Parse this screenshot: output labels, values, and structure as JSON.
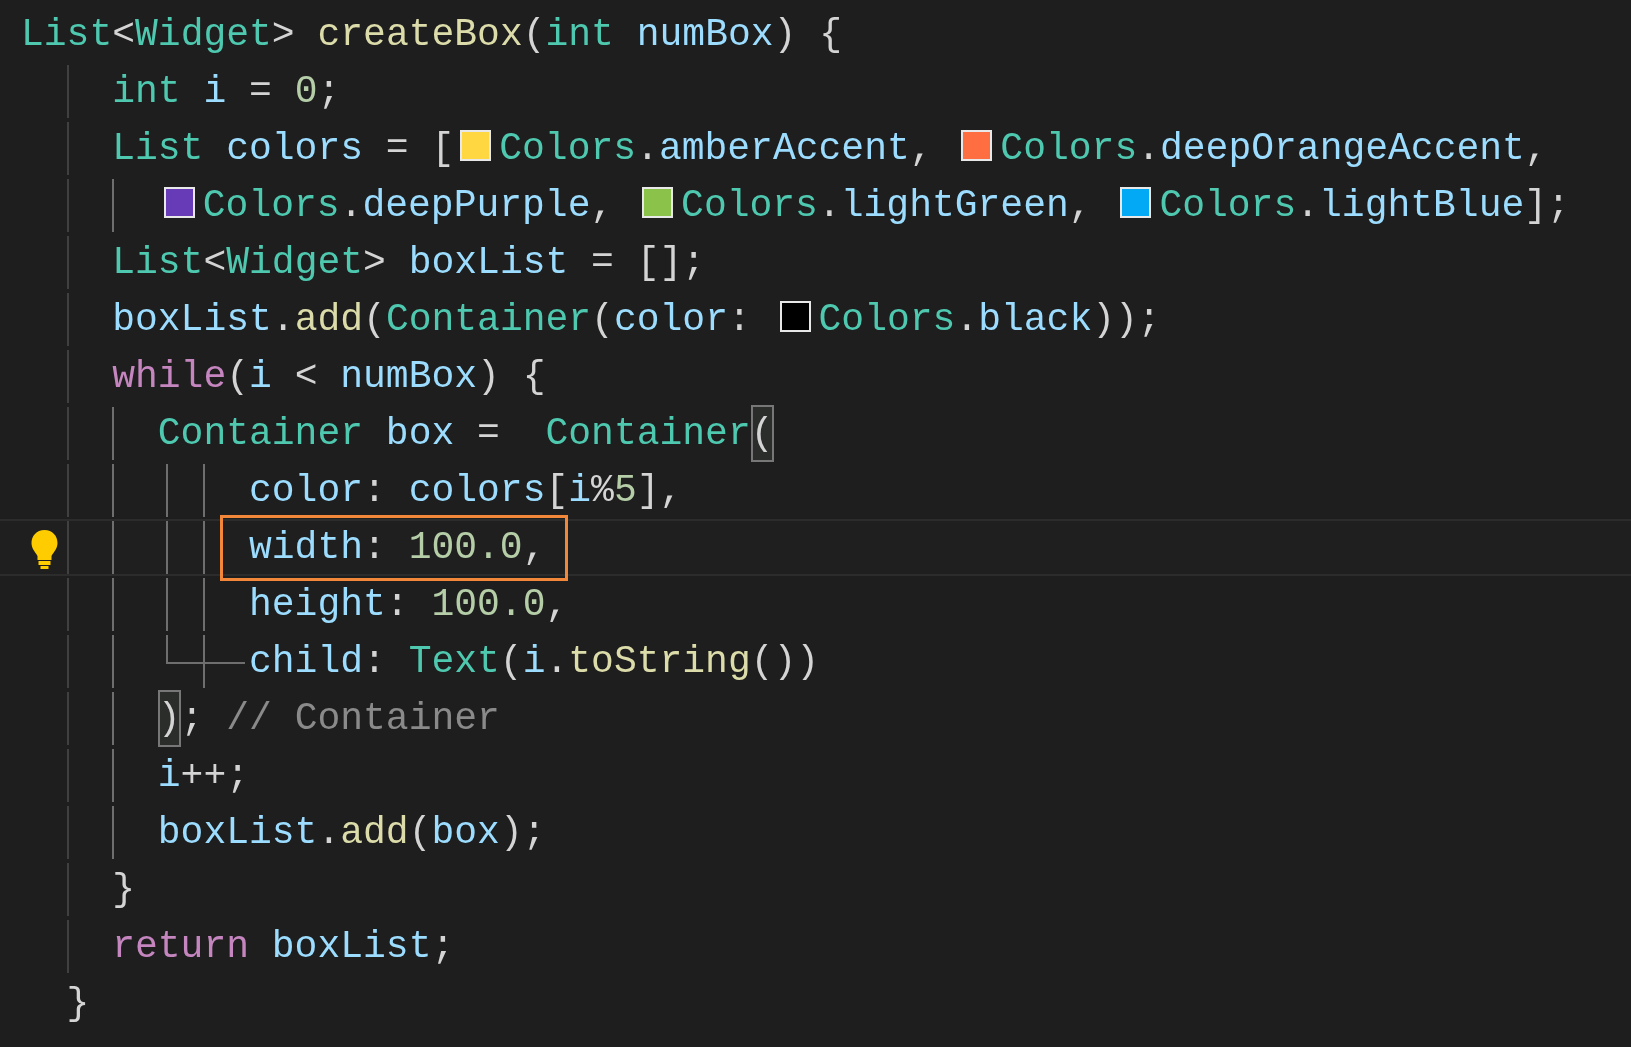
{
  "lines": [
    {
      "tokens": [
        {
          "kind": "type",
          "text": "List"
        },
        {
          "kind": "punct",
          "text": "<"
        },
        {
          "kind": "type",
          "text": "Widget"
        },
        {
          "kind": "punct",
          "text": "> "
        },
        {
          "kind": "func",
          "text": "createBox"
        },
        {
          "kind": "punct",
          "text": "("
        },
        {
          "kind": "type",
          "text": "int"
        },
        {
          "kind": "var",
          "text": " numBox"
        },
        {
          "kind": "punct",
          "text": ") {"
        }
      ],
      "children": [
        {
          "tokens": [
            {
              "kind": "type",
              "text": "int"
            },
            {
              "kind": "var",
              "text": " i"
            },
            {
              "kind": "punct",
              "text": " = "
            },
            {
              "kind": "number",
              "text": "0"
            },
            {
              "kind": "punct",
              "text": ";"
            }
          ]
        },
        {
          "tokens": [
            {
              "kind": "type",
              "text": "List"
            },
            {
              "kind": "var",
              "text": " colors"
            },
            {
              "kind": "punct",
              "text": " = ["
            },
            {
              "kind": "swatch",
              "color": "#ffd740"
            },
            {
              "kind": "type",
              "text": "Colors"
            },
            {
              "kind": "punct",
              "text": "."
            },
            {
              "kind": "var",
              "text": "amberAccent"
            },
            {
              "kind": "punct",
              "text": ", "
            },
            {
              "kind": "swatch",
              "color": "#ff6e40"
            },
            {
              "kind": "type",
              "text": "Colors"
            },
            {
              "kind": "punct",
              "text": "."
            },
            {
              "kind": "var",
              "text": "deepOrangeAccent"
            },
            {
              "kind": "punct",
              "text": ","
            }
          ],
          "children": [
            {
              "tokens": [
                {
                  "kind": "swatch",
                  "color": "#673ab7"
                },
                {
                  "kind": "type",
                  "text": "Colors"
                },
                {
                  "kind": "punct",
                  "text": "."
                },
                {
                  "kind": "var",
                  "text": "deepPurple"
                },
                {
                  "kind": "punct",
                  "text": ", "
                },
                {
                  "kind": "swatch",
                  "color": "#8bc34a"
                },
                {
                  "kind": "type",
                  "text": "Colors"
                },
                {
                  "kind": "punct",
                  "text": "."
                },
                {
                  "kind": "var",
                  "text": "lightGreen"
                },
                {
                  "kind": "punct",
                  "text": ", "
                },
                {
                  "kind": "swatch",
                  "color": "#03a9f4"
                },
                {
                  "kind": "type",
                  "text": "Colors"
                },
                {
                  "kind": "punct",
                  "text": "."
                },
                {
                  "kind": "var",
                  "text": "lightBlue"
                },
                {
                  "kind": "punct",
                  "text": "];"
                }
              ]
            }
          ]
        },
        {
          "tokens": [
            {
              "kind": "type",
              "text": "List"
            },
            {
              "kind": "punct",
              "text": "<"
            },
            {
              "kind": "type",
              "text": "Widget"
            },
            {
              "kind": "punct",
              "text": ">"
            },
            {
              "kind": "var",
              "text": " boxList"
            },
            {
              "kind": "punct",
              "text": " = [];"
            }
          ]
        },
        {
          "tokens": [
            {
              "kind": "var",
              "text": "boxList"
            },
            {
              "kind": "punct",
              "text": "."
            },
            {
              "kind": "func",
              "text": "add"
            },
            {
              "kind": "punct",
              "text": "("
            },
            {
              "kind": "type",
              "text": "Container"
            },
            {
              "kind": "punct",
              "text": "("
            },
            {
              "kind": "var",
              "text": "color"
            },
            {
              "kind": "punct",
              "text": ": "
            },
            {
              "kind": "swatch",
              "color": "#000000"
            },
            {
              "kind": "type",
              "text": "Colors"
            },
            {
              "kind": "punct",
              "text": "."
            },
            {
              "kind": "var",
              "text": "black"
            },
            {
              "kind": "punct",
              "text": "));"
            }
          ]
        },
        {
          "tokens": [
            {
              "kind": "control",
              "text": "while"
            },
            {
              "kind": "punct",
              "text": "("
            },
            {
              "kind": "var",
              "text": "i"
            },
            {
              "kind": "punct",
              "text": " < "
            },
            {
              "kind": "var",
              "text": "numBox"
            },
            {
              "kind": "punct",
              "text": ") {"
            }
          ],
          "children": [
            {
              "outline": true,
              "tokens": [
                {
                  "kind": "type",
                  "text": "Container"
                },
                {
                  "kind": "var",
                  "text": " box"
                },
                {
                  "kind": "punct",
                  "text": " =  "
                },
                {
                  "kind": "type",
                  "text": "Container"
                },
                {
                  "kind": "punct",
                  "text": "(",
                  "matched": true
                }
              ],
              "children": [
                {
                  "current": false,
                  "boxed": false,
                  "tokens": [
                    {
                      "kind": "var",
                      "text": "color"
                    },
                    {
                      "kind": "punct",
                      "text": ": "
                    },
                    {
                      "kind": "var",
                      "text": "colors"
                    },
                    {
                      "kind": "punct",
                      "text": "["
                    },
                    {
                      "kind": "var",
                      "text": "i"
                    },
                    {
                      "kind": "punct",
                      "text": "%"
                    },
                    {
                      "kind": "number",
                      "text": "5"
                    },
                    {
                      "kind": "punct",
                      "text": "],"
                    }
                  ]
                },
                {
                  "current": true,
                  "boxed": true,
                  "tokens": [
                    {
                      "kind": "var",
                      "text": "width"
                    },
                    {
                      "kind": "punct",
                      "text": ": "
                    },
                    {
                      "kind": "number",
                      "text": "100.0"
                    },
                    {
                      "kind": "punct",
                      "text": ","
                    }
                  ]
                },
                {
                  "current": false,
                  "boxed": false,
                  "tokens": [
                    {
                      "kind": "var",
                      "text": "height"
                    },
                    {
                      "kind": "punct",
                      "text": ": "
                    },
                    {
                      "kind": "number",
                      "text": "100.0"
                    },
                    {
                      "kind": "punct",
                      "text": ","
                    }
                  ]
                },
                {
                  "current": false,
                  "boxed": false,
                  "tokens": [
                    {
                      "kind": "var",
                      "text": "child"
                    },
                    {
                      "kind": "punct",
                      "text": ": "
                    },
                    {
                      "kind": "type",
                      "text": "Text"
                    },
                    {
                      "kind": "punct",
                      "text": "("
                    },
                    {
                      "kind": "var",
                      "text": "i"
                    },
                    {
                      "kind": "punct",
                      "text": "."
                    },
                    {
                      "kind": "func",
                      "text": "toString"
                    },
                    {
                      "kind": "punct",
                      "text": "())"
                    }
                  ]
                }
              ],
              "close": [
                {
                  "kind": "punct",
                  "text": ")",
                  "matched": true
                },
                {
                  "kind": "punct",
                  "text": "; "
                },
                {
                  "kind": "comment",
                  "text": "// Container"
                }
              ]
            },
            {
              "tokens": [
                {
                  "kind": "var",
                  "text": "i"
                },
                {
                  "kind": "punct",
                  "text": "++;"
                }
              ]
            },
            {
              "tokens": [
                {
                  "kind": "var",
                  "text": "boxList"
                },
                {
                  "kind": "punct",
                  "text": "."
                },
                {
                  "kind": "func",
                  "text": "add"
                },
                {
                  "kind": "punct",
                  "text": "("
                },
                {
                  "kind": "var",
                  "text": "box"
                },
                {
                  "kind": "punct",
                  "text": ");"
                }
              ]
            }
          ],
          "close": [
            {
              "kind": "punct",
              "text": "}"
            }
          ]
        },
        {
          "tokens": [
            {
              "kind": "control",
              "text": "return"
            },
            {
              "kind": "var",
              "text": " boxList"
            },
            {
              "kind": "punct",
              "text": ";"
            }
          ]
        }
      ],
      "close": [
        {
          "kind": "punct",
          "text": "}"
        }
      ]
    }
  ]
}
